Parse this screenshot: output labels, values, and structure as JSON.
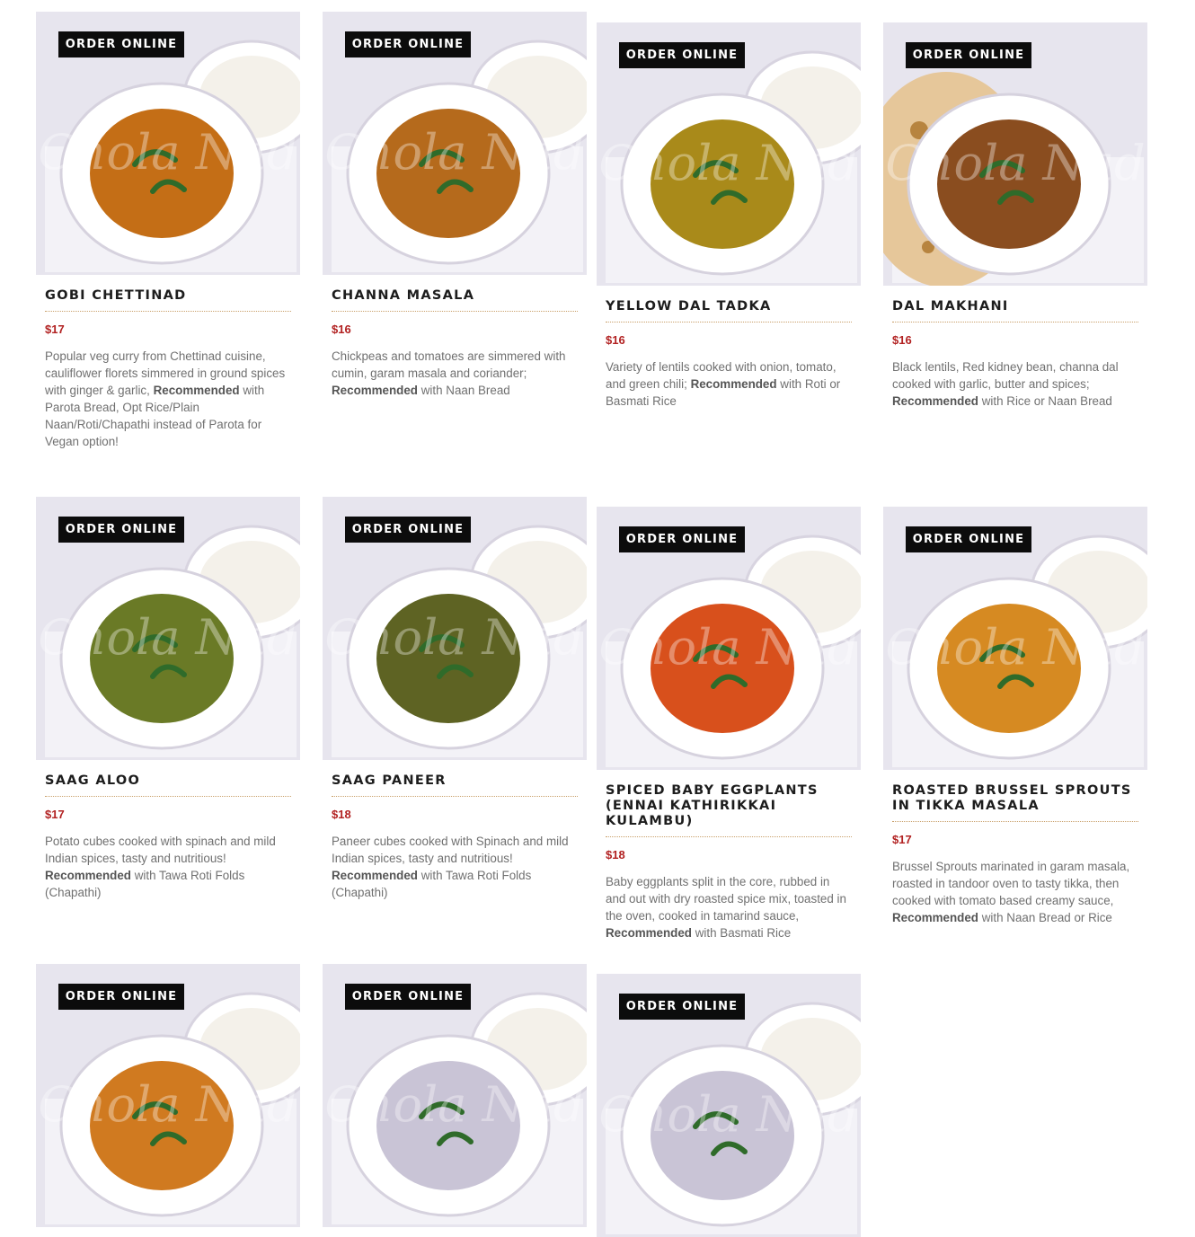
{
  "order_label": "ORDER ONLINE",
  "watermark": "Chola Nad",
  "colors": {
    "price": "#b22222",
    "button_bg": "#0c0c0c",
    "divider": "#c9a06a"
  },
  "items": [
    {
      "title": "GOBI CHETTINAD",
      "price": "$17",
      "desc": "Popular veg curry from Chettinad cuisine, cauliflower florets simmered in ground spices with ginger & garlic,",
      "rec": "Recommended",
      "desc_after": "with Parota Bread, Opt Rice/Plain Naan/Roti/Chapathi instead of Parota for Vegan option!",
      "curry": "#c46e16",
      "side": "rice"
    },
    {
      "title": "CHANNA MASALA",
      "price": "$16",
      "desc": "Chickpeas and tomatoes are simmered with cumin, garam masala and coriander;",
      "rec": "Recommended",
      "desc_after": "with Naan Bread",
      "curry": "#b56a1c",
      "side": "rice"
    },
    {
      "title": "YELLOW DAL TADKA",
      "price": "$16",
      "desc": "Variety of lentils cooked with onion, tomato, and green chili;",
      "rec": "Recommended",
      "desc_after": "with Roti or Basmati Rice",
      "curry": "#a98a1a",
      "side": "rice"
    },
    {
      "title": "DAL MAKHANI",
      "price": "$16",
      "desc": "Black lentils, Red kidney bean, channa dal cooked with garlic, butter and spices;",
      "rec": "Recommended",
      "desc_after": "with Rice or Naan Bread",
      "curry": "#8a4d1f",
      "side": "naan"
    },
    {
      "title": "SAAG ALOO",
      "price": "$17",
      "desc": "Potato cubes cooked with spinach and mild Indian spices, tasty and nutritious!",
      "rec": "Recommended",
      "desc_after": "with Tawa Roti Folds (Chapathi)",
      "curry": "#6a7a26",
      "side": "rice"
    },
    {
      "title": "SAAG PANEER",
      "price": "$18",
      "desc": "Paneer cubes cooked with Spinach and mild Indian spices, tasty and nutritious!",
      "rec": "Recommended",
      "desc_after": "with Tawa Roti Folds (Chapathi)",
      "curry": "#5e6323",
      "side": "rice"
    },
    {
      "title": "SPICED BABY EGGPLANTS (ENNAI KATHIRIKKAI KULAMBU)",
      "price": "$18",
      "desc": "Baby eggplants split in the core, rubbed in and out with dry roasted spice mix, toasted in the oven, cooked in tamarind sauce,",
      "rec": "Recommended",
      "desc_after": "with Basmati Rice",
      "curry": "#d8501c",
      "side": "rice"
    },
    {
      "title": "ROASTED BRUSSEL SPROUTS IN TIKKA MASALA",
      "price": "$17",
      "desc": "Brussel Sprouts marinated in garam masala, roasted in tandoor oven to tasty tikka, then cooked with tomato based creamy sauce,",
      "rec": "Recommended",
      "desc_after": "with Naan Bread or Rice",
      "curry": "#d68a22",
      "side": "rice"
    },
    {
      "title": "",
      "price": "",
      "desc": "",
      "rec": "",
      "desc_after": "",
      "curry": "#d07a20",
      "side": "rice"
    },
    {
      "title": "",
      "price": "",
      "desc": "",
      "rec": "",
      "desc_after": "",
      "curry": "#c9c4d6",
      "side": "rice"
    },
    {
      "title": "",
      "price": "",
      "desc": "",
      "rec": "",
      "desc_after": "",
      "curry": "#c9c4d6",
      "side": "rice"
    }
  ]
}
